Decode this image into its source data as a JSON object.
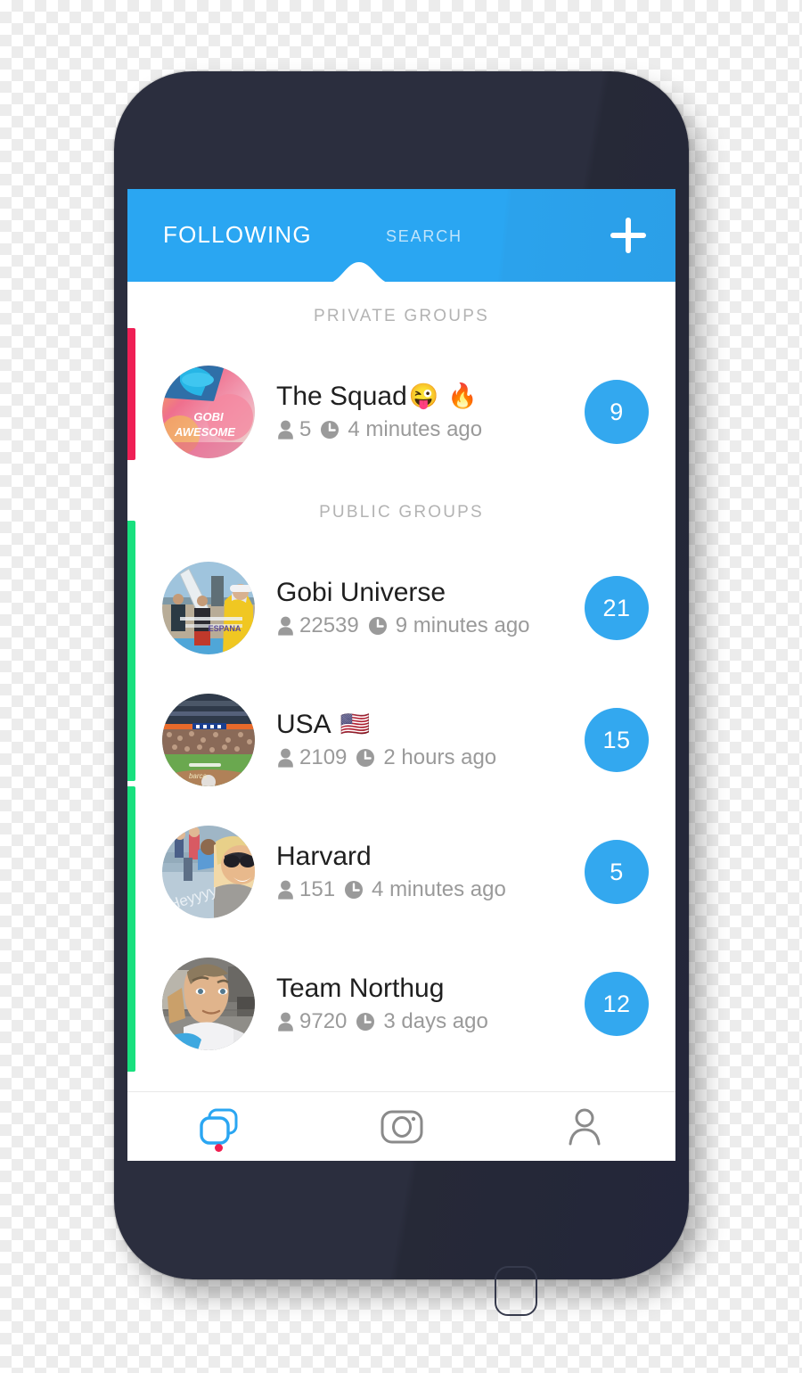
{
  "header": {
    "tab_following": "FOLLOWING",
    "tab_search": "SEARCH",
    "add_label": "+",
    "accent_blue": "#2aa6f2"
  },
  "sections": [
    {
      "label": "PRIVATE GROUPS",
      "edge_color": "#ef1f55"
    },
    {
      "label": "PUBLIC GROUPS",
      "edge_color": "#18e07e"
    }
  ],
  "private_groups": [
    {
      "name": "The Squad",
      "emoji1": "😜",
      "emoji2": "🔥",
      "members": "5",
      "time": "4 minutes ago",
      "badge": "9",
      "avatar": "gobi-awesome-art"
    }
  ],
  "public_groups": [
    {
      "name": "Gobi Universe",
      "emoji1": "",
      "emoji2": "",
      "members": "22539",
      "time": "9 minutes ago",
      "badge": "21",
      "avatar": "beach-surfboard-photo"
    },
    {
      "name": "USA",
      "emoji1": "🇺🇸",
      "emoji2": "",
      "members": "2109",
      "time": "2 hours ago",
      "badge": "15",
      "avatar": "baseball-stadium-photo"
    },
    {
      "name": "Harvard",
      "emoji1": "",
      "emoji2": "",
      "members": "151",
      "time": "4 minutes ago",
      "badge": "5",
      "avatar": "woman-sunglasses-photo"
    },
    {
      "name": "Team Northug",
      "emoji1": "",
      "emoji2": "",
      "members": "9720",
      "time": "3 days ago",
      "badge": "12",
      "avatar": "man-portrait-photo"
    }
  ],
  "icons": {
    "member": "person-icon",
    "time": "clock-icon",
    "add": "plus-icon"
  },
  "bottom_tabs": [
    {
      "name": "groups",
      "icon": "stacked-cards-icon",
      "active": true,
      "dot": true
    },
    {
      "name": "camera",
      "icon": "camera-icon",
      "active": false,
      "dot": false
    },
    {
      "name": "profile",
      "icon": "person-outline-icon",
      "active": false,
      "dot": false
    }
  ],
  "badge_color": "#33a8ef",
  "dot_color": "#f01f50"
}
